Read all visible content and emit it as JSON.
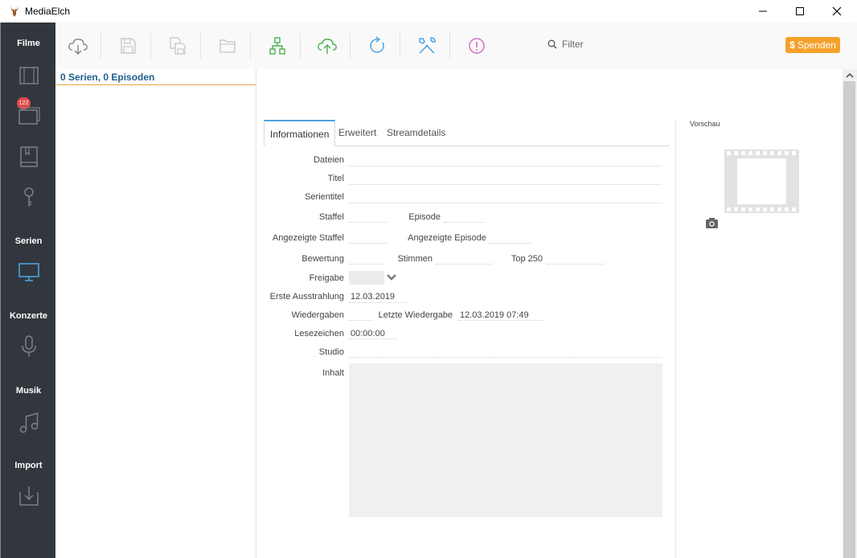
{
  "window": {
    "title": "MediaElch"
  },
  "sidebar": {
    "sections": [
      {
        "label": "Filme"
      },
      {
        "label": "Serien"
      },
      {
        "label": "Konzerte"
      },
      {
        "label": "Musik"
      },
      {
        "label": "Import"
      }
    ],
    "badge": "122"
  },
  "toolbar": {
    "icons": [
      "cloud-download-icon",
      "save-icon",
      "save-all-icon",
      "folder-icon",
      "network-icon",
      "cloud-upload-icon",
      "reload-icon",
      "tools-icon",
      "info-icon"
    ],
    "filter_label": "Filter",
    "donate_label": "Spenden",
    "donate_symbol": "$",
    "accent": "#f4a12b"
  },
  "list": {
    "header": "0 Serien, 0 Episoden"
  },
  "tabs": [
    "Informationen",
    "Erweitert",
    "Streamdetails"
  ],
  "fields": {
    "dateien": "Dateien",
    "titel": "Titel",
    "serientitel": "Serientitel",
    "staffel": "Staffel",
    "episode": "Episode",
    "angezeigte_staffel": "Angezeigte Staffel",
    "angezeigte_episode": "Angezeigte Episode",
    "bewertung": "Bewertung",
    "stimmen": "Stimmen",
    "top250": "Top 250",
    "freigabe": "Freigabe",
    "erste_ausstrahlung": "Erste Ausstrahlung",
    "erste_ausstrahlung_value": "12.03.2019",
    "wiedergaben": "Wiedergaben",
    "letzte_wiedergabe": "Letzte Wiedergabe",
    "letzte_wiedergabe_value": "12.03.2019 07:49",
    "lesezeichen": "Lesezeichen",
    "lesezeichen_value": "00:00:00",
    "studio": "Studio",
    "inhalt": "Inhalt"
  },
  "preview": {
    "label": "Vorschau"
  }
}
